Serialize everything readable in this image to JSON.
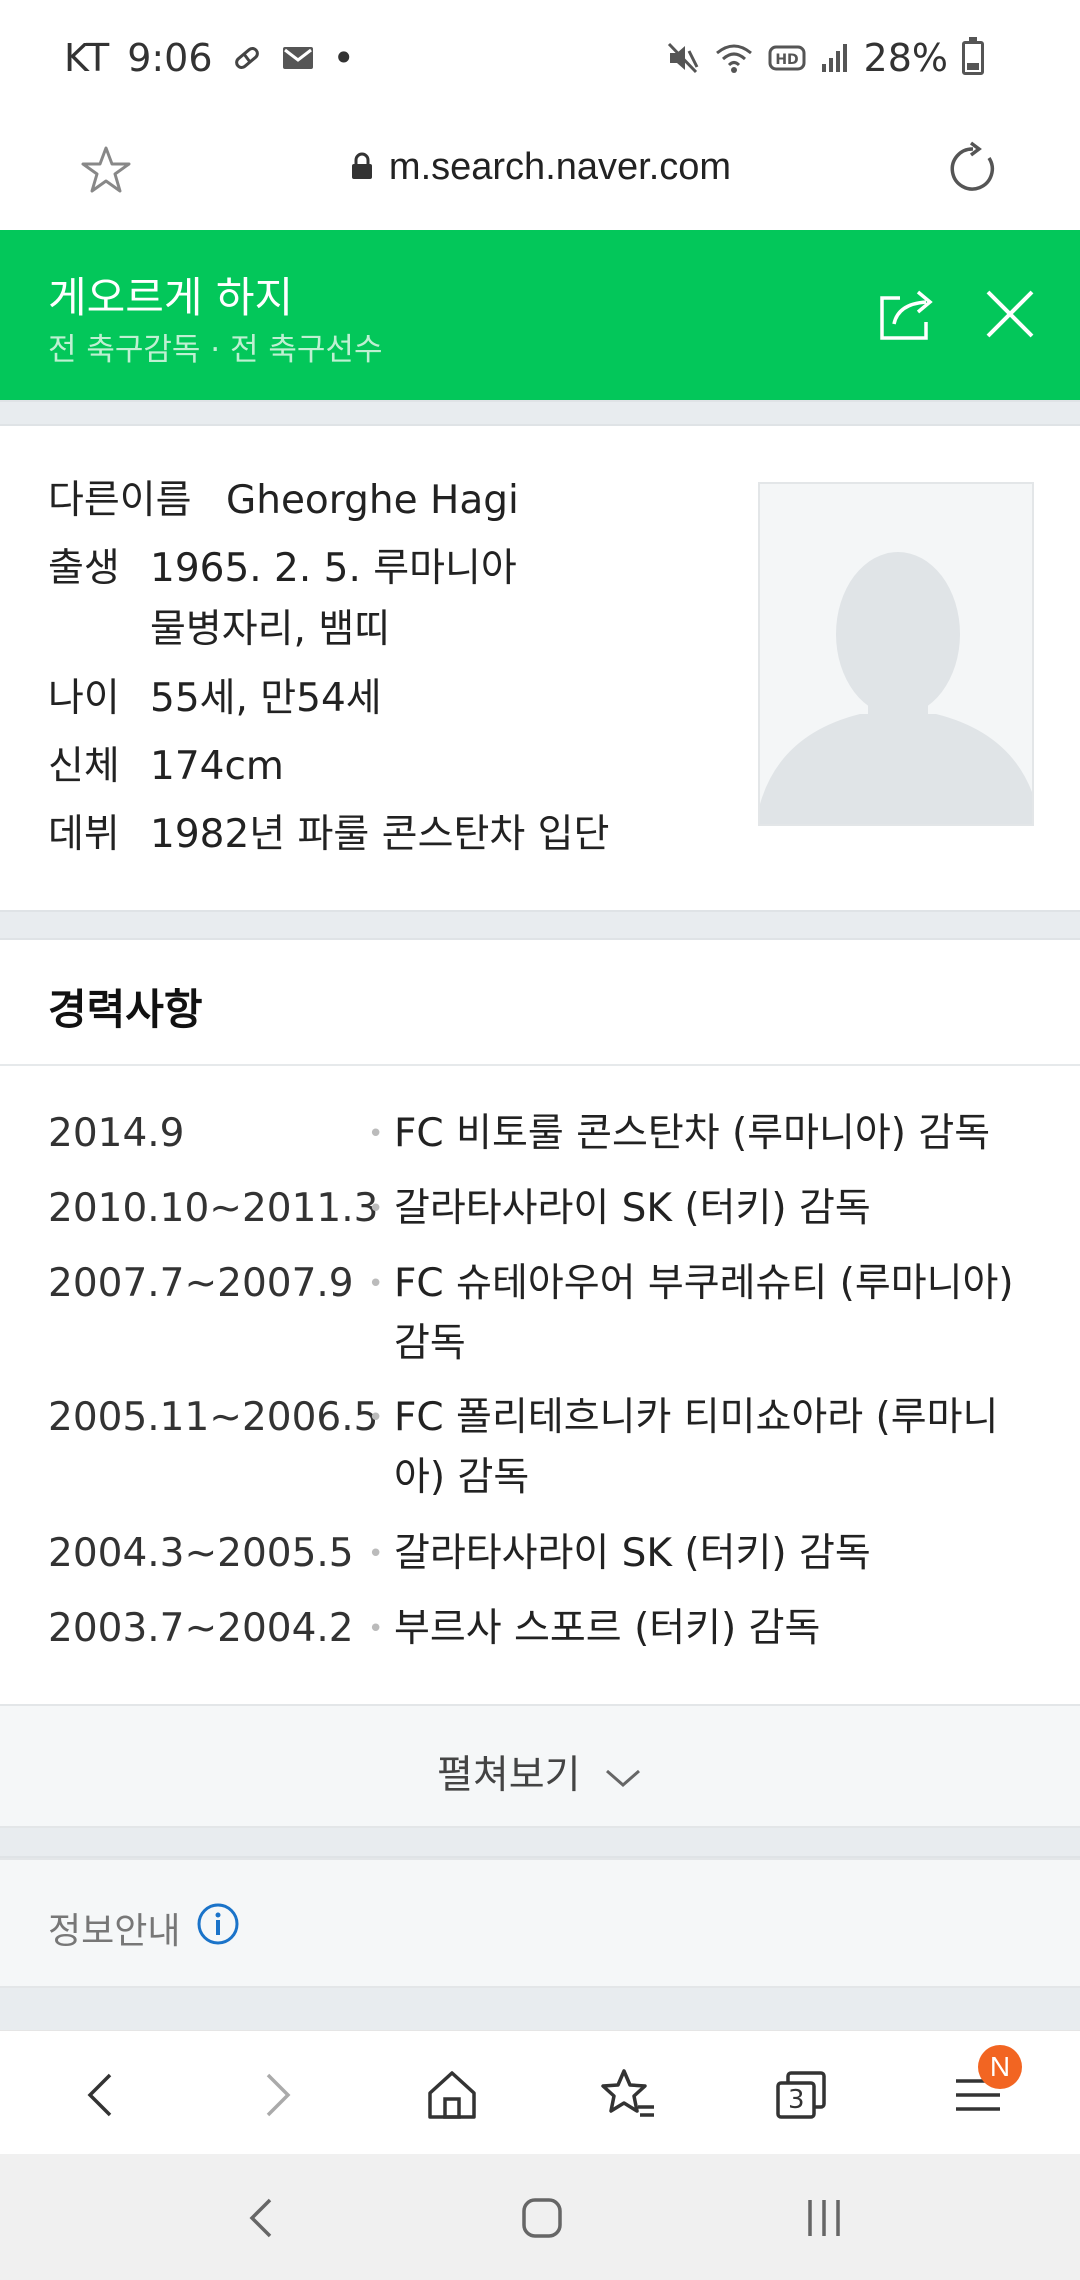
{
  "status_bar": {
    "carrier": "KT",
    "time": "9:06",
    "dot": "•",
    "battery": "28%",
    "icons": [
      "pill-icon",
      "mail-icon",
      "mute-icon",
      "wifi-icon",
      "hd-icon",
      "signal-icon",
      "battery-icon"
    ]
  },
  "address_bar": {
    "url": "m.search.naver.com"
  },
  "header": {
    "title": "게오르게 하지",
    "subtitle": "전 축구감독 · 전 축구선수",
    "color": "#03c75a"
  },
  "profile": {
    "alias_label": "다른이름",
    "alias_value": "Gheorghe Hagi",
    "birth_label": "출생",
    "birth_value": "1965. 2. 5. 루마니아",
    "birth_value_2": "물병자리, 뱀띠",
    "age_label": "나이",
    "age_value": "55세, 만54세",
    "body_label": "신체",
    "body_value": "174cm",
    "debut_label": "데뷔",
    "debut_value": "1982년 파룰 콘스탄차 입단"
  },
  "career": {
    "title": "경력사항",
    "items": [
      {
        "date": "2014.9",
        "text": "FC 비토룰 콘스탄차 (루마니아) 감독"
      },
      {
        "date": "2010.10~2011.3",
        "text": "갈라타사라이 SK (터키) 감독"
      },
      {
        "date": "2007.7~2007.9",
        "text": "FC 슈테아우어 부쿠레슈티 (루마니아) 감독"
      },
      {
        "date": "2005.11~2006.5",
        "text": "FC 폴리테흐니카 티미쇼아라 (루마니아) 감독"
      },
      {
        "date": "2004.3~2005.5",
        "text": "갈라타사라이 SK (터키) 감독"
      },
      {
        "date": "2003.7~2004.2",
        "text": "부르사 스포르 (터키) 감독"
      }
    ],
    "more_label": "펼쳐보기"
  },
  "info": {
    "label": "정보안내"
  },
  "toolbar": {
    "tabs_count": "3",
    "menu_badge": "N",
    "badge_color": "#f26522"
  }
}
